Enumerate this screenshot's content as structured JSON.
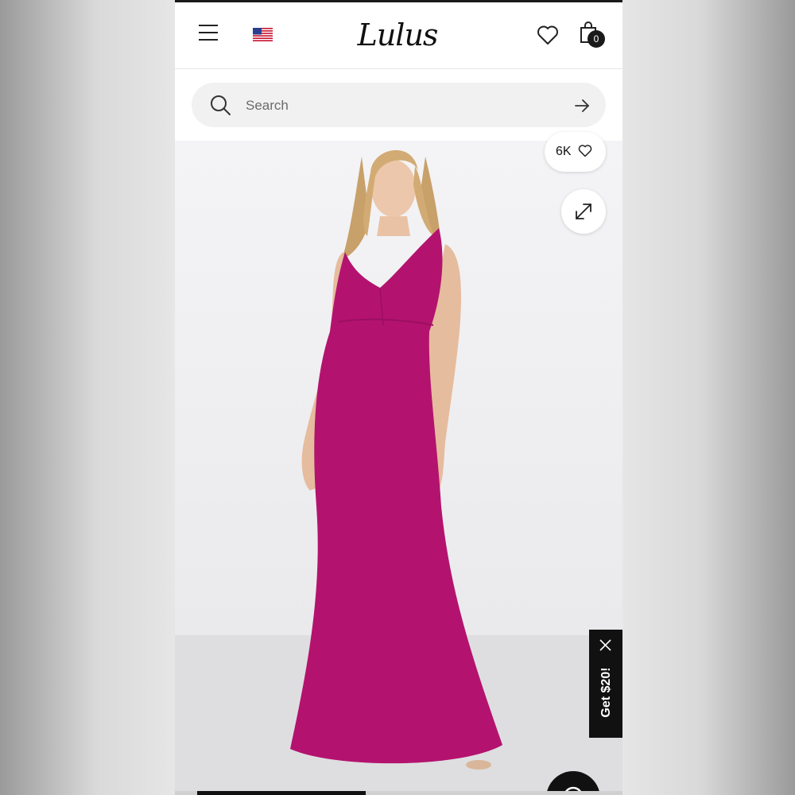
{
  "header": {
    "logo_text": "Lulus",
    "menu_icon": "hamburger-menu-icon",
    "flag_icon": "us-flag-icon",
    "wishlist_icon": "heart-outline-icon",
    "bag_icon": "shopping-bag-icon",
    "bag_count": "0"
  },
  "search": {
    "placeholder": "Search",
    "value": ""
  },
  "product": {
    "likes_count": "6K",
    "dress_color": "#b3136f"
  },
  "promo": {
    "label": "Get $20!"
  },
  "colors": {
    "brand": "#111111",
    "dress": "#b3136f"
  }
}
